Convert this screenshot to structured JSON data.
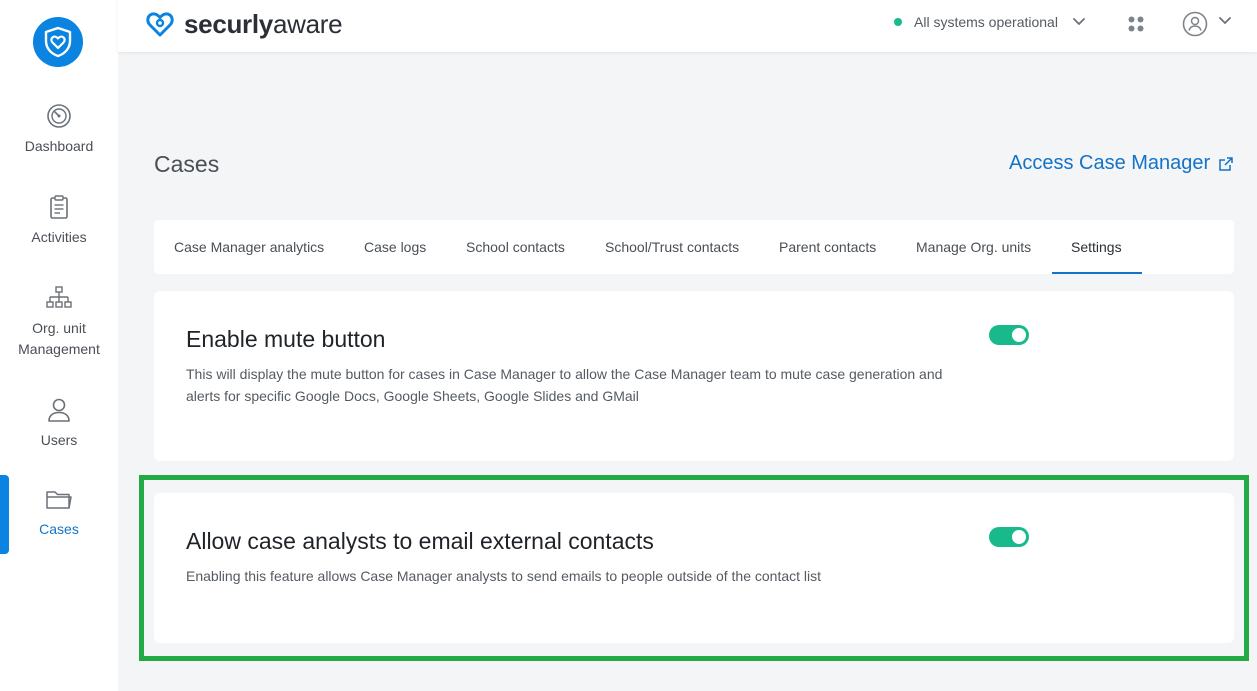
{
  "brand": {
    "name_part1": "securly",
    "name_part2": "aware"
  },
  "sidebar": {
    "items": [
      {
        "label": "Dashboard",
        "icon": "gauge-icon"
      },
      {
        "label": "Activities",
        "icon": "clipboard-icon"
      },
      {
        "label": "Org. unit Management",
        "icon": "org-chart-icon"
      },
      {
        "label": "Users",
        "icon": "user-icon"
      },
      {
        "label": "Cases",
        "icon": "folder-icon"
      }
    ],
    "active": "Cases"
  },
  "header": {
    "status_text": "All systems operational",
    "status_color": "#18b98a"
  },
  "page": {
    "title": "Cases",
    "access_link": "Access Case Manager"
  },
  "tabs": [
    {
      "label": "Case Manager analytics"
    },
    {
      "label": "Case logs"
    },
    {
      "label": "School contacts"
    },
    {
      "label": "School/Trust contacts"
    },
    {
      "label": "Parent contacts"
    },
    {
      "label": "Manage Org. units"
    },
    {
      "label": "Settings"
    }
  ],
  "active_tab": "Settings",
  "settings": [
    {
      "title": "Enable mute button",
      "description": "This will display the mute button for cases in Case Manager to allow the Case Manager team to mute case generation and alerts for specific Google Docs, Google Sheets, Google Slides and GMail",
      "enabled": true
    },
    {
      "title": "Allow case analysts to email external contacts",
      "description": "Enabling this feature allows Case Manager analysts to send emails to people outside of the contact list",
      "enabled": true
    }
  ],
  "colors": {
    "accent": "#1473c7",
    "toggle_on": "#18b98a",
    "highlight": "#22aa44"
  }
}
